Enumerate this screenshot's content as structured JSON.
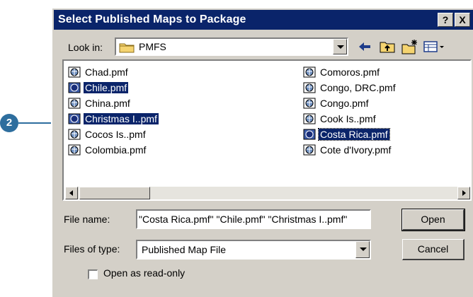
{
  "window": {
    "title": "Select Published Maps to Package",
    "help_button": "?",
    "close_button": "X"
  },
  "look_in": {
    "label": "Look in:",
    "value": "PMFS",
    "icon": "folder-icon"
  },
  "toolbar": {
    "back_icon": "back-arrow-icon",
    "up_icon": "up-folder-icon",
    "new_folder_icon": "new-folder-icon",
    "view_menu_icon": "view-menu-icon"
  },
  "files": [
    {
      "name": "Chad.pmf",
      "selected": false
    },
    {
      "name": "Chile.pmf",
      "selected": true
    },
    {
      "name": "China.pmf",
      "selected": false
    },
    {
      "name": "Christmas I..pmf",
      "selected": true
    },
    {
      "name": "Cocos Is..pmf",
      "selected": false
    },
    {
      "name": "Colombia.pmf",
      "selected": false
    },
    {
      "name": "Comoros.pmf",
      "selected": false
    },
    {
      "name": "Congo, DRC.pmf",
      "selected": false
    },
    {
      "name": "Congo.pmf",
      "selected": false
    },
    {
      "name": "Cook Is..pmf",
      "selected": false
    },
    {
      "name": "Costa Rica.pmf",
      "selected": true
    },
    {
      "name": "Cote d'Ivory.pmf",
      "selected": false
    }
  ],
  "file_name": {
    "label": "File name:",
    "value": "\"Costa Rica.pmf\" \"Chile.pmf\" \"Christmas I..pmf\""
  },
  "file_type": {
    "label": "Files of type:",
    "value": "Published Map File"
  },
  "buttons": {
    "open": "Open",
    "cancel": "Cancel"
  },
  "read_only": {
    "label": "Open as read-only",
    "checked": false
  },
  "callout": {
    "number": "2"
  },
  "colors": {
    "title_bar": "#0a246a",
    "selection": "#0a246a",
    "dialog_face": "#d4d0c8",
    "callout": "#2e6e9e"
  }
}
